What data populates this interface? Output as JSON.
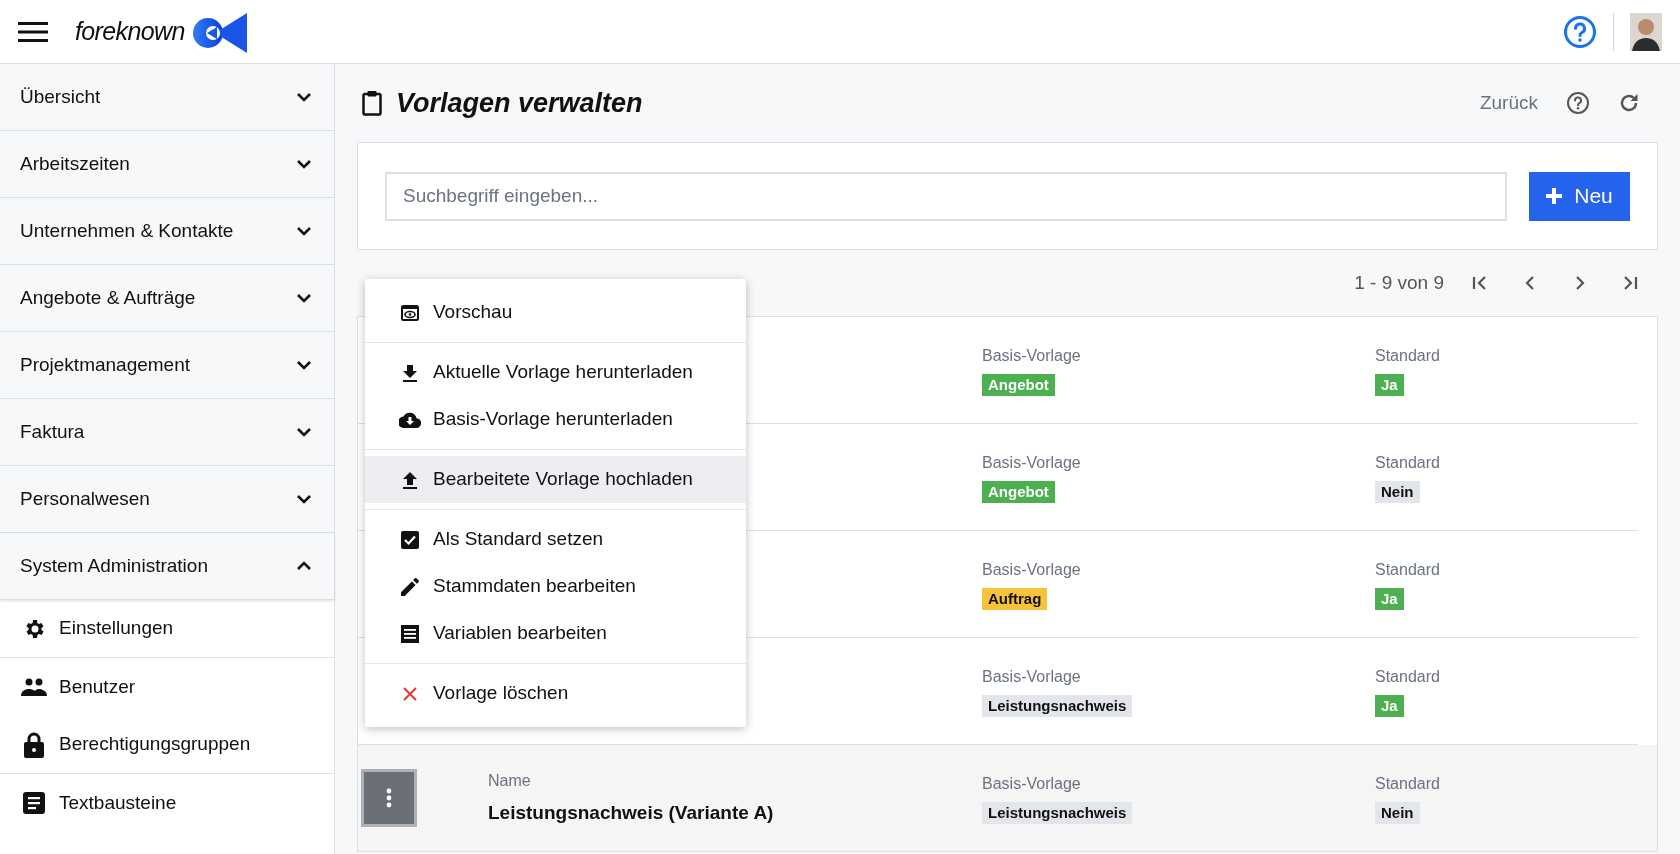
{
  "header": {
    "logo_text": "foreknown"
  },
  "sidebar": {
    "sections": [
      {
        "label": "Übersicht",
        "expanded": false
      },
      {
        "label": "Arbeitszeiten",
        "expanded": false
      },
      {
        "label": "Unternehmen & Kontakte",
        "expanded": false
      },
      {
        "label": "Angebote & Aufträge",
        "expanded": false
      },
      {
        "label": "Projektmanagement",
        "expanded": false
      },
      {
        "label": "Faktura",
        "expanded": false
      },
      {
        "label": "Personalwesen",
        "expanded": false
      },
      {
        "label": "System Administration",
        "expanded": true,
        "children": [
          {
            "label": "Einstellungen",
            "kind": "gear"
          },
          {
            "label": "Benutzer",
            "kind": "users"
          },
          {
            "label": "Berechtigungsgruppen",
            "kind": "lock"
          },
          {
            "label": "Textbausteine",
            "kind": "document"
          }
        ]
      }
    ]
  },
  "page": {
    "title": "Vorlagen verwalten",
    "back": "Zurück"
  },
  "search": {
    "placeholder": "Suchbegriff eingeben...",
    "new_button": "Neu"
  },
  "pagination": {
    "range": "1 - 9 von 9"
  },
  "table": {
    "rows": [
      {
        "selected": false,
        "base_label": "Basis-Vorlage",
        "base": {
          "text": "Angebot",
          "color": "#4caf50"
        },
        "default_label": "Standard",
        "default": {
          "text": "Ja",
          "color": "#4caf50"
        }
      },
      {
        "selected": false,
        "base_label": "Basis-Vorlage",
        "base": {
          "text": "Angebot",
          "color": "#4caf50"
        },
        "default_label": "Standard",
        "default": {
          "text": "Nein",
          "color": "#e2e5ea"
        }
      },
      {
        "selected": false,
        "base_label": "Basis-Vorlage",
        "base": {
          "text": "Auftrag",
          "color": "#f7c23c"
        },
        "default_label": "Standard",
        "default": {
          "text": "Ja",
          "color": "#4caf50"
        }
      },
      {
        "selected": false,
        "base_label": "Basis-Vorlage",
        "base": {
          "text": "Leistungsnachweis",
          "color": "#e2e5ea"
        },
        "default_label": "Standard",
        "default": {
          "text": "Ja",
          "color": "#4caf50"
        }
      },
      {
        "selected": true,
        "name_label": "Name",
        "name": "Leistungsnachweis (Variante A)",
        "base_label": "Basis-Vorlage",
        "base": {
          "text": "Leistungsnachweis",
          "color": "#e2e5ea"
        },
        "default_label": "Standard",
        "default": {
          "text": "Nein",
          "color": "#e2e5ea"
        }
      }
    ]
  },
  "context_menu": {
    "groups": [
      [
        {
          "label": "Vorschau",
          "kind": "preview",
          "hovered": false
        }
      ],
      [
        {
          "label": "Aktuelle Vorlage herunterladen",
          "kind": "download",
          "hovered": false
        },
        {
          "label": "Basis-Vorlage herunterladen",
          "kind": "cloud-download",
          "hovered": false
        }
      ],
      [
        {
          "label": "Bearbeitete Vorlage hochladen",
          "kind": "upload",
          "hovered": true
        }
      ],
      [
        {
          "label": "Als Standard setzen",
          "kind": "checkbox",
          "hovered": false
        },
        {
          "label": "Stammdaten bearbeiten",
          "kind": "pencil",
          "hovered": false
        },
        {
          "label": "Variablen bearbeiten",
          "kind": "list",
          "hovered": false
        }
      ],
      [
        {
          "label": "Vorlage löschen",
          "kind": "delete",
          "hovered": false
        }
      ]
    ]
  }
}
